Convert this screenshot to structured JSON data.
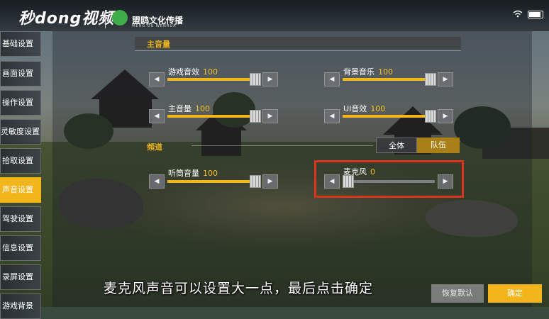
{
  "branding": {
    "watermark": "秒dong视频",
    "partner_name": "盟鸥文化传播",
    "partner_sub": "MENG OU WENHUA"
  },
  "sidebar": {
    "items": [
      {
        "label": "基础设置",
        "active": false
      },
      {
        "label": "画面设置",
        "active": false
      },
      {
        "label": "操作设置",
        "active": false
      },
      {
        "label": "灵敏度设置",
        "active": false
      },
      {
        "label": "拾取设置",
        "active": false
      },
      {
        "label": "声音设置",
        "active": true
      },
      {
        "label": "驾驶设置",
        "active": false
      },
      {
        "label": "信息设置",
        "active": false
      },
      {
        "label": "录屏设置",
        "active": false
      },
      {
        "label": "游戏背景",
        "active": false
      }
    ]
  },
  "sections": {
    "main_volume": "主音量",
    "channel": "频道"
  },
  "sliders": {
    "game_sfx": {
      "label": "游戏音效",
      "value": "100"
    },
    "bg_music": {
      "label": "背景音乐",
      "value": "100"
    },
    "master": {
      "label": "主音量",
      "value": "100"
    },
    "ui_sfx": {
      "label": "UI音效",
      "value": "100"
    },
    "earpiece": {
      "label": "听筒音量",
      "value": "100"
    },
    "microphone": {
      "label": "麦克风",
      "value": "0"
    }
  },
  "channel_toggle": {
    "all": "全体",
    "team": "队伍",
    "selected": "team"
  },
  "buttons": {
    "reset": "恢复默认",
    "confirm": "确定"
  },
  "arrows": {
    "left": "◀",
    "right": "▶"
  },
  "caption": "麦克风声音可以设置大一点，最后点击确定",
  "colors": {
    "accent": "#f2b51c",
    "highlight_box": "#e0331c"
  }
}
